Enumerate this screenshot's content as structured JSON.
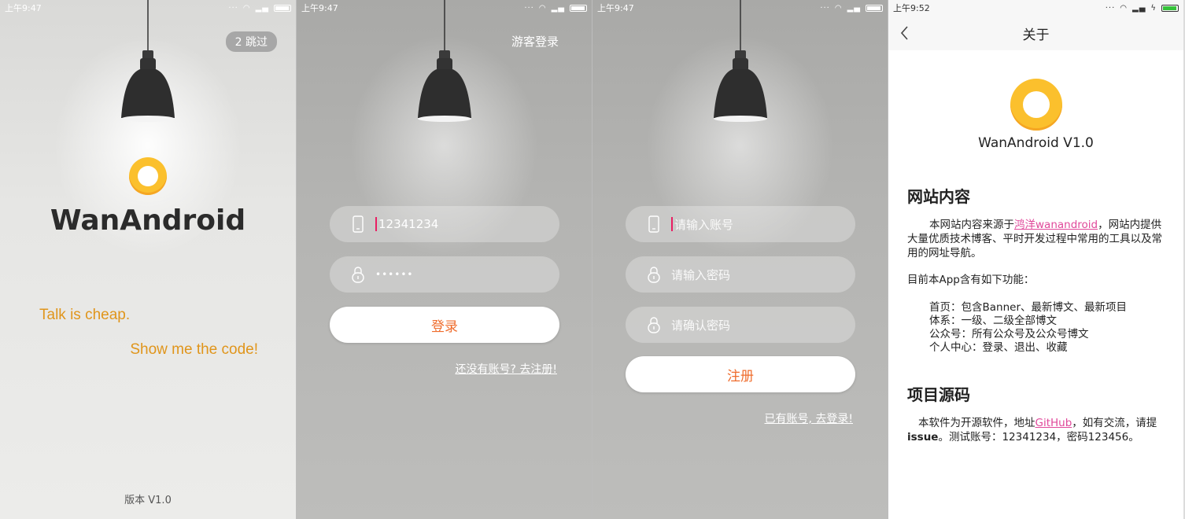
{
  "splash": {
    "status_time": "上午9:47",
    "skip_label": "2 跳过",
    "app_name": "WanAndroid",
    "slogan_line1": "Talk is cheap.",
    "slogan_line2": "Show me the code!",
    "version": "版本 V1.0"
  },
  "login": {
    "status_time": "上午9:47",
    "guest_label": "游客登录",
    "account_value": "12341234",
    "password_value": "••••••",
    "login_button": "登录",
    "register_link": "还没有账号? 去注册!"
  },
  "register": {
    "status_time": "上午9:47",
    "account_placeholder": "请输入账号",
    "password_placeholder": "请输入密码",
    "confirm_placeholder": "请确认密码",
    "register_button": "注册",
    "login_link": "已有账号, 去登录!"
  },
  "about": {
    "status_time": "上午9:52",
    "title": "关于",
    "app_version": "WanAndroid  V1.0",
    "section1_title": "网站内容",
    "section1_para_pre": "本网站内容来源于",
    "section1_link": "鸿洋wanandroid",
    "section1_para_post": "，网站内提供大量优质技术博客、平时开发过程中常用的工具以及常用的网址导航。",
    "features_intro": "目前本App含有如下功能：",
    "features": [
      "首页：包含Banner、最新博文、最新项目",
      "体系：一级、二级全部博文",
      "公众号：所有公众号及公众号博文",
      "个人中心：登录、退出、收藏"
    ],
    "section2_title": "项目源码",
    "section2_pre": "本软件为开源软件，地址",
    "section2_link": "GitHub",
    "section2_mid": "，如有交流，请提",
    "section2_bold": "issue",
    "section2_post": "。测试账号：12341234，密码123456。"
  },
  "colors": {
    "accent_orange": "#ef6c2c",
    "slogan": "#e0951b",
    "logo_yellow": "#fbc02d",
    "link_pink": "#e0489a"
  }
}
